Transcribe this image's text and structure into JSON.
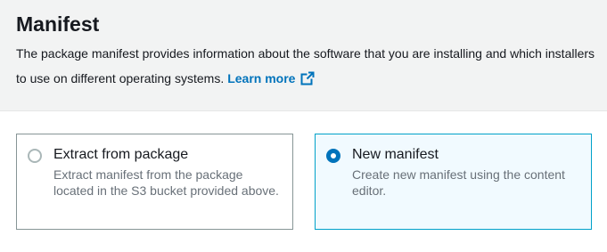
{
  "section": {
    "title": "Manifest",
    "description": "The package manifest provides information about the software that you are installing and which installers to use on different operating systems.",
    "learn_more_label": "Learn more"
  },
  "options": [
    {
      "label": "Extract from package",
      "description": "Extract manifest from the package located in the S3 bucket provided above.",
      "selected": false
    },
    {
      "label": "New manifest",
      "description": "Create new manifest using the content editor.",
      "selected": true
    }
  ],
  "colors": {
    "link": "#0073bb",
    "selected_border": "#00a1c9",
    "selected_bg": "#f1faff",
    "radio_checked": "#0073bb"
  },
  "icons": {
    "learn_more": "external-link-icon"
  }
}
